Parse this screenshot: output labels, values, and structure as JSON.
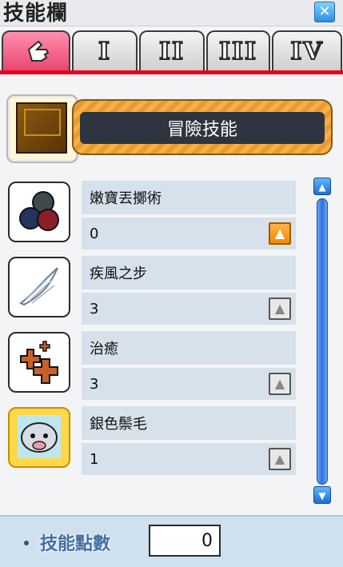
{
  "window": {
    "title": "技能欄",
    "close_icon": "close-icon"
  },
  "tabs": [
    {
      "id": "beginner",
      "label": "",
      "icon": "hand-pointer-icon",
      "active": true
    },
    {
      "id": "first",
      "label": "I",
      "active": false
    },
    {
      "id": "second",
      "label": "II",
      "active": false
    },
    {
      "id": "third",
      "label": "III",
      "active": false
    },
    {
      "id": "fourth",
      "label": "IV",
      "active": false
    }
  ],
  "job": {
    "name": "冒險技能",
    "icon": "skill-book-icon"
  },
  "skills": [
    {
      "name": "嫩寶丟擲術",
      "level": "0",
      "icon": "snail-shell-throw-icon",
      "upgrade_enabled": true
    },
    {
      "name": "疾風之步",
      "level": "3",
      "icon": "feather-wing-icon",
      "upgrade_enabled": false
    },
    {
      "name": "治癒",
      "level": "3",
      "icon": "heal-cross-icon",
      "upgrade_enabled": false
    },
    {
      "name": "銀色鬃毛",
      "level": "1",
      "icon": "silver-boar-icon",
      "upgrade_enabled": false
    }
  ],
  "scrollbar": {
    "up_icon": "arrow-up-icon",
    "down_icon": "arrow-down-icon"
  },
  "footer": {
    "sp_label": "技能點數",
    "sp_value": "0"
  },
  "colors": {
    "active_tab": "#e8476f",
    "accent_red": "#e8001a",
    "upgrade_enabled": "#f08c00",
    "scrollbar": "#2e6fe0"
  }
}
